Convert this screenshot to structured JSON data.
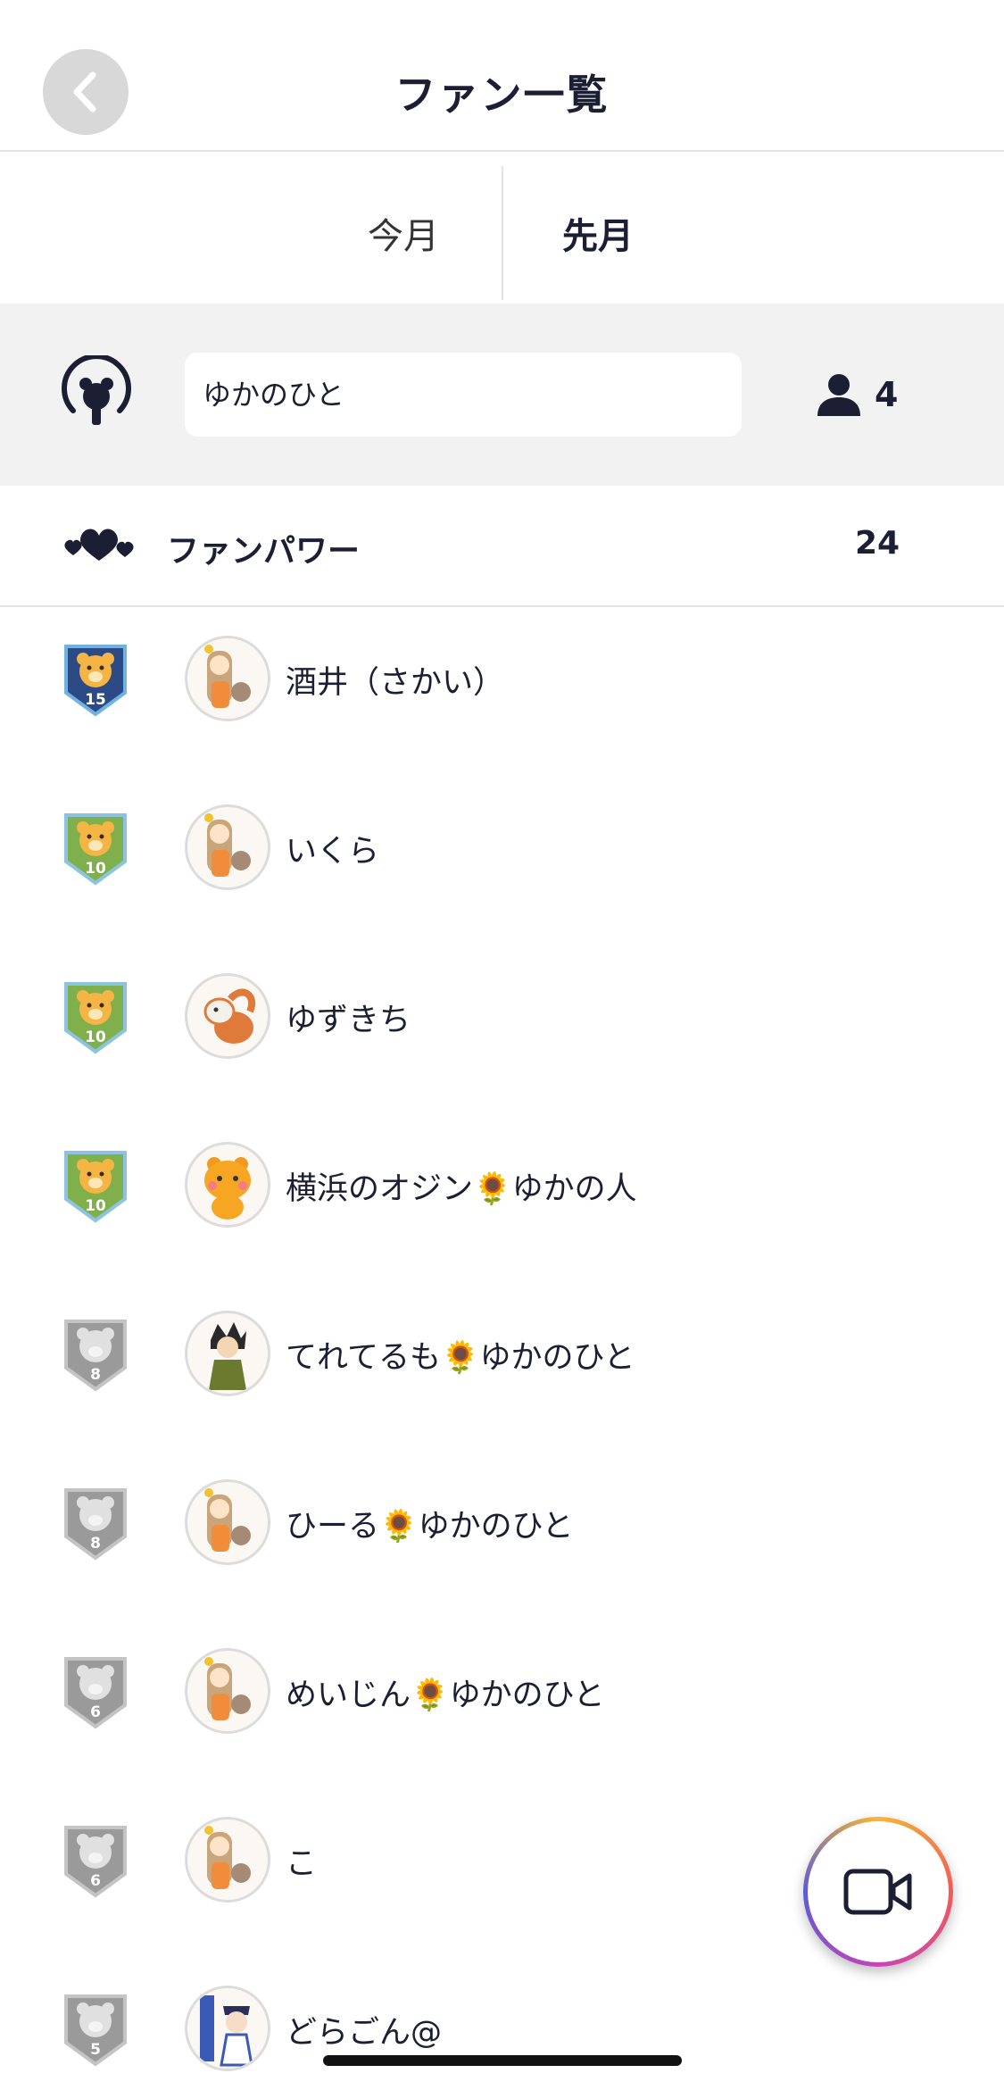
{
  "header": {
    "title": "ファン一覧"
  },
  "tabs": {
    "this_month": "今月",
    "last_month": "先月"
  },
  "info": {
    "name": "ゆかのひと",
    "user_count": "4"
  },
  "fan_power": {
    "label": "ファンパワー",
    "value": "24"
  },
  "colors": {
    "badge_blue": "#2c4a86",
    "badge_green": "#7fb04c",
    "badge_silver": "#9a9a9a",
    "text": "#1c1f33"
  },
  "fans": [
    {
      "name": "酒井（さかい）",
      "level": "15",
      "badge": "blue"
    },
    {
      "name": "いくら",
      "level": "10",
      "badge": "green"
    },
    {
      "name": "ゆずきち",
      "level": "10",
      "badge": "green"
    },
    {
      "name": "横浜のオジン🌻ゆかの人",
      "level": "10",
      "badge": "green"
    },
    {
      "name": "てれてるも🌻ゆかのひと",
      "level": "8",
      "badge": "silver"
    },
    {
      "name": "ひーる🌻ゆかのひと",
      "level": "8",
      "badge": "silver"
    },
    {
      "name": "めいじん🌻ゆかのひと",
      "level": "6",
      "badge": "silver"
    },
    {
      "name": "こ",
      "level": "6",
      "badge": "silver"
    },
    {
      "name": "どらごん@",
      "level": "5",
      "badge": "silver"
    }
  ]
}
